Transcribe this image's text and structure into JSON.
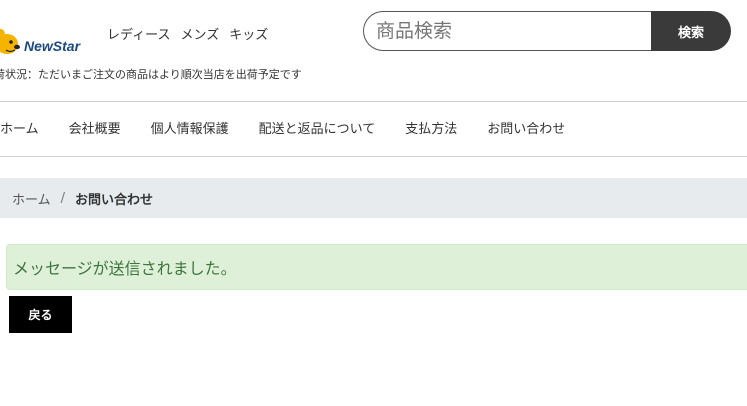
{
  "header": {
    "logo_text": "NewStar",
    "categories": [
      "レディース",
      "メンズ",
      "キッズ"
    ],
    "search": {
      "placeholder": "商品検索",
      "value": "",
      "button_label": "検索"
    },
    "notice": "荷状況：ただいまご注文の商品はより順次当店を出荷予定です"
  },
  "main_nav": [
    "ホーム",
    "会社概要",
    "個人情報保護",
    "配送と返品について",
    "支払方法",
    "お問い合わせ"
  ],
  "breadcrumb": {
    "home": "ホーム",
    "separator": "/",
    "current": "お問い合わせ"
  },
  "alert": {
    "message": "メッセージが送信されました。"
  },
  "back_button_label": "戻る",
  "colors": {
    "logo_yellow": "#f5b400",
    "logo_text": "#1a4a80",
    "search_button": "#3a3a3a",
    "alert_bg": "#dff0d8",
    "alert_text": "#3c763d",
    "breadcrumb_bg": "#e8ebee"
  }
}
